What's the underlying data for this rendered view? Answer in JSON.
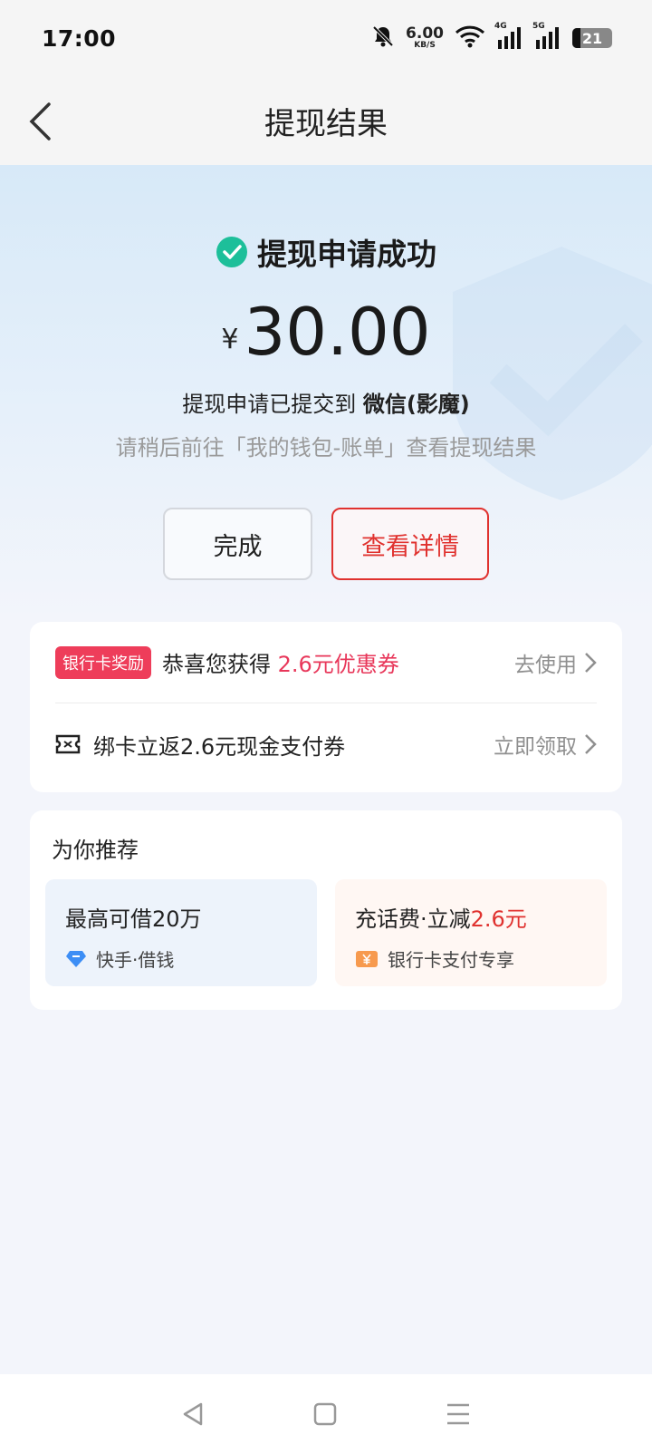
{
  "status": {
    "time": "17:00",
    "net_speed": "6.00",
    "net_unit": "KB/S",
    "sig1_tag": "4G",
    "sig2_tag": "5G",
    "battery": "21"
  },
  "nav": {
    "title": "提现结果"
  },
  "result": {
    "success_text": "提现申请成功",
    "currency": "¥",
    "amount": "30.00",
    "submitted_prefix": "提现申请已提交到 ",
    "submitted_target": "微信(影魔)",
    "hint": "请稍后前往「我的钱包-账单」查看提现结果"
  },
  "buttons": {
    "done": "完成",
    "detail": "查看详情"
  },
  "rewards": {
    "badge": "银行卡奖励",
    "congrats_prefix": "恭喜您获得 ",
    "congrats_highlight": "2.6元优惠券",
    "use_action": "去使用",
    "bind_text": "绑卡立返2.6元现金支付券",
    "claim_action": "立即领取"
  },
  "recommend": {
    "title": "为你推荐",
    "items": [
      {
        "main": "最高可借20万",
        "main_highlight": "",
        "sub": "快手·借钱",
        "icon": "diamond-icon"
      },
      {
        "main": "充话费·立减",
        "main_highlight": "2.6元",
        "sub": "银行卡支付专享",
        "icon": "yuan-coupon-icon"
      }
    ]
  },
  "colors": {
    "accent_red": "#e0322f",
    "success_green": "#1dbf9a",
    "badge_pink": "#ee3d5a"
  }
}
